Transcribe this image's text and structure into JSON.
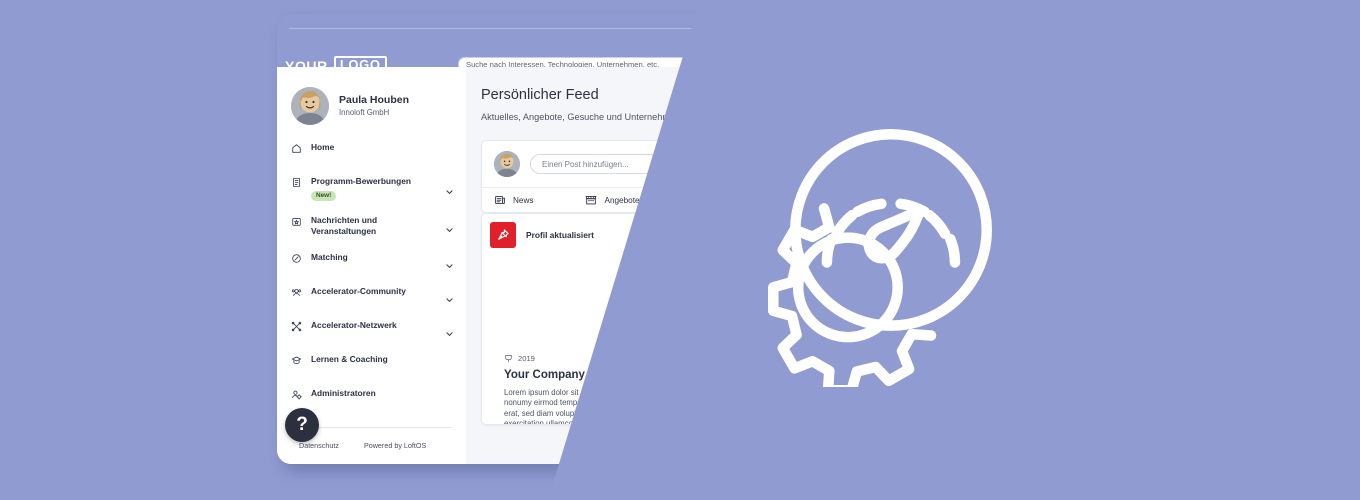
{
  "page": {
    "background_color": "#8f9bd1",
    "overlay_color": "#8f9bd1",
    "card_background": "#f5f6fa"
  },
  "header": {
    "logo_word": "YOUR",
    "logo_boxed_word": "LOGO",
    "search": {
      "placeholder": "Suche nach Interessen, Technologien, Unternehmen, etc.",
      "value": ""
    }
  },
  "sidebar": {
    "profile": {
      "name": "Paula Houben",
      "organization": "Innoloft GmbH",
      "avatar_icon": "user-photo-avatar"
    },
    "items": [
      {
        "label": "Home",
        "icon": "home-icon",
        "has_chevron": false,
        "badge": ""
      },
      {
        "label": "Programm-Bewerbungen",
        "icon": "document-list-icon",
        "has_chevron": true,
        "badge": "New!"
      },
      {
        "label": "Nachrichten und Veranstaltungen",
        "icon": "calendar-star-icon",
        "has_chevron": true,
        "badge": ""
      },
      {
        "label": "Matching",
        "icon": "target-circle-icon",
        "has_chevron": true,
        "badge": ""
      },
      {
        "label": "Accelerator-Community",
        "icon": "people-group-icon",
        "has_chevron": true,
        "badge": ""
      },
      {
        "label": "Accelerator-Netzwerk",
        "icon": "network-nodes-icon",
        "has_chevron": true,
        "badge": ""
      },
      {
        "label": "Lernen & Coaching",
        "icon": "graduation-cap-icon",
        "has_chevron": false,
        "badge": ""
      },
      {
        "label": "Administratoren",
        "icon": "user-settings-icon",
        "has_chevron": false,
        "badge": ""
      }
    ],
    "badge_color": "#c9e5b4",
    "help_button": "?",
    "footer": {
      "privacy": "Datenschutz",
      "powered_by": "Powered by LoftOS"
    }
  },
  "main": {
    "title": "Persönlicher Feed",
    "subtitle": "Aktuelles, Angebote, Gesuche und Unternehmen, die",
    "composer": {
      "avatar_icon": "user-photo-avatar",
      "placeholder": "Einen Post hinzufügen...",
      "tabs": [
        {
          "label": "News",
          "icon": "newspaper-icon"
        },
        {
          "label": "Angebote",
          "icon": "storefront-icon"
        },
        {
          "label": "",
          "icon": "megaphone-icon"
        }
      ]
    },
    "post": {
      "badge_label": "Profil aktualisiert",
      "badge_icon": "pushpin-icon",
      "badge_color": "#e0202b",
      "company": {
        "year": "2019",
        "year_icon": "award-ribbon-icon",
        "name": "Your Company",
        "body": "Lorem ipsum dolor sit amet, consetetur sadipscing elitr, sed diam nonumy eirmod tempor invidunt ut labore et dolore magna aliquyam erat, sed diam voluptua. Ut enim ad minim veniam, quis nostrud exercitation ullamco laboris nisi ut aliquip ex ea commodo consequat. Duis aute irure dolor in reprehenderit in voluptate velit esse cillum dolore eu fugiat nulla pariatur. Excepteur sint occaecat cupidatat non proident, sunt in culpa qui officia deserunt mollit anim id est laborum."
      }
    }
  },
  "overlay_art": {
    "icon": "speedometer-gauge-with-gear-icon",
    "color": "#ffffff"
  }
}
